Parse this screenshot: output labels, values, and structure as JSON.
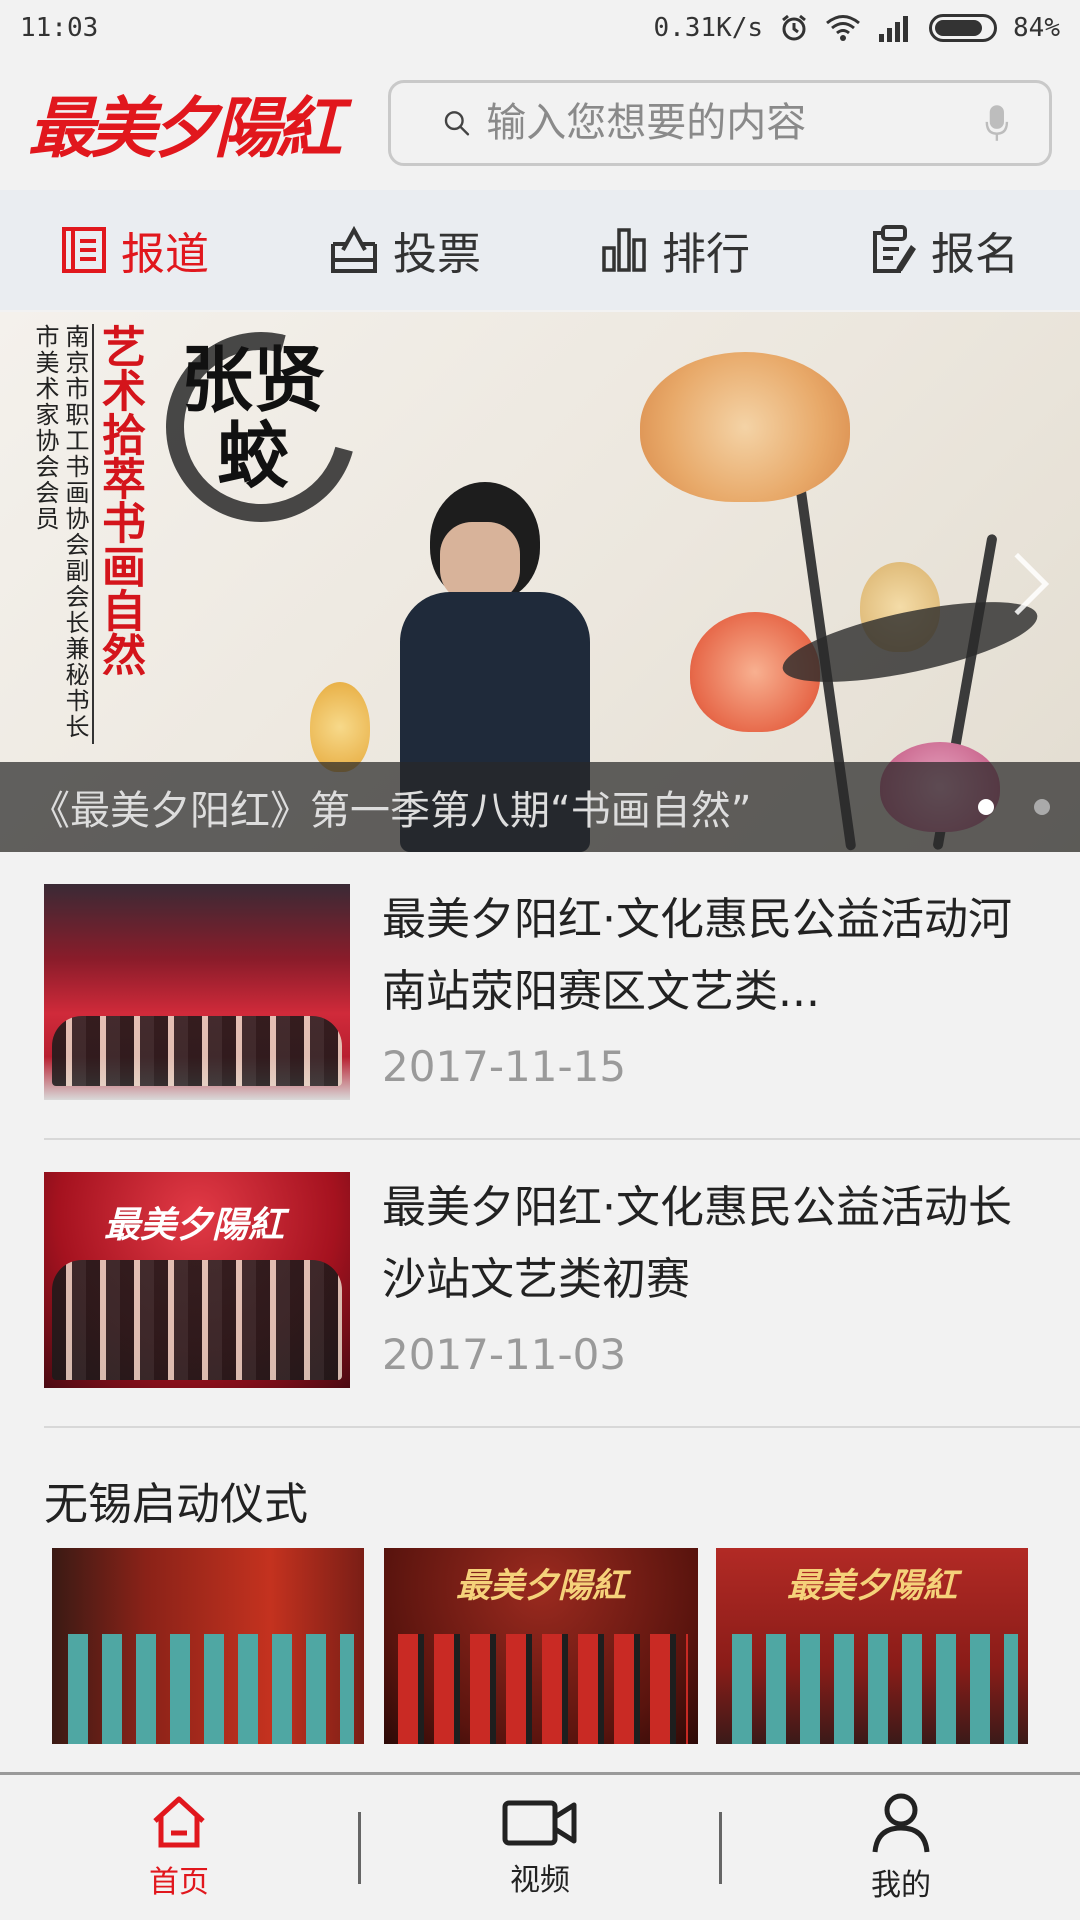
{
  "status_bar": {
    "time": "11:03",
    "network_speed": "0.31K/s",
    "battery": "84%",
    "battery_level": 0.84
  },
  "header": {
    "logo_text": "最美夕陽紅",
    "search_placeholder": "输入您想要的内容"
  },
  "nav_tabs": [
    {
      "label": "报道",
      "icon": "document-icon",
      "active": true
    },
    {
      "label": "投票",
      "icon": "ballot-box-icon",
      "active": false
    },
    {
      "label": "排行",
      "icon": "bar-chart-icon",
      "active": false
    },
    {
      "label": "报名",
      "icon": "edit-form-icon",
      "active": false
    }
  ],
  "banner": {
    "caption": "《最美夕阳红》第一季第八期“书画自然”",
    "side_text_1": "南京市职工书画协会副会长兼秘书长",
    "side_text_2": "市美术家协会会员",
    "red_text": "艺术拾萃书画自然",
    "calligraphy": "张贤蛟",
    "slide_count": 2,
    "active_slide": 1
  },
  "news": [
    {
      "title": "最美夕阳红·文化惠民公益活动河南站荥阳赛区文艺类...",
      "date": "2017-11-15"
    },
    {
      "title": "最美夕阳红·文化惠民公益活动长沙站文艺类初赛",
      "date": "2017-11-03"
    }
  ],
  "gallery": {
    "title": "无锡启动仪式",
    "image_logo_2": "最美夕陽紅",
    "image_logo_3": "最美夕陽紅"
  },
  "bottom_nav": [
    {
      "label": "首页",
      "icon": "home-icon",
      "active": true
    },
    {
      "label": "视频",
      "icon": "video-camera-icon",
      "active": false
    },
    {
      "label": "我的",
      "icon": "user-icon",
      "active": false
    }
  ],
  "colors": {
    "accent": "#e1171d",
    "nav_bg": "#eaedf1",
    "page_bg": "#f2f2f2"
  }
}
